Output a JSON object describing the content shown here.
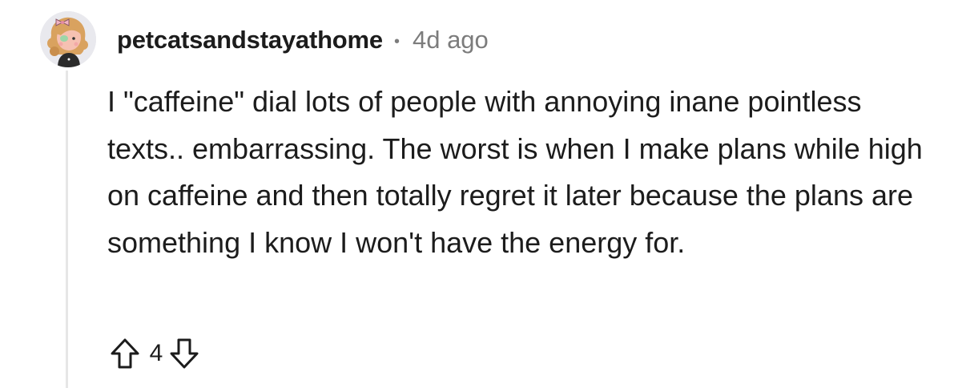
{
  "comment": {
    "avatar": {
      "icon": "cartoon-avatar-icon",
      "colors": {
        "background": "#e9e9ee",
        "hair": "#d9a25f",
        "skin": "#f6c1b2",
        "bow": "#f2b3c2",
        "shirt": "#2b2b2b",
        "eye": "#9dd6a8"
      }
    },
    "username": "petcatsandstayathome",
    "separator": "•",
    "timestamp": "4d ago",
    "body": "I \"caffeine\" dial lots of people with annoying inane pointless texts.. embarrassing. The worst is when I make plans while high on caffeine and then totally regret it later because the plans are something I know I won't have the energy for.",
    "actions": {
      "upvote_icon": "arrow-up-icon",
      "vote_count": "4",
      "downvote_icon": "arrow-down-icon"
    }
  },
  "colors": {
    "text_primary": "#1c1c1c",
    "text_secondary": "#7c7c7c",
    "thread_line": "#e6e6e6",
    "background": "#ffffff"
  }
}
